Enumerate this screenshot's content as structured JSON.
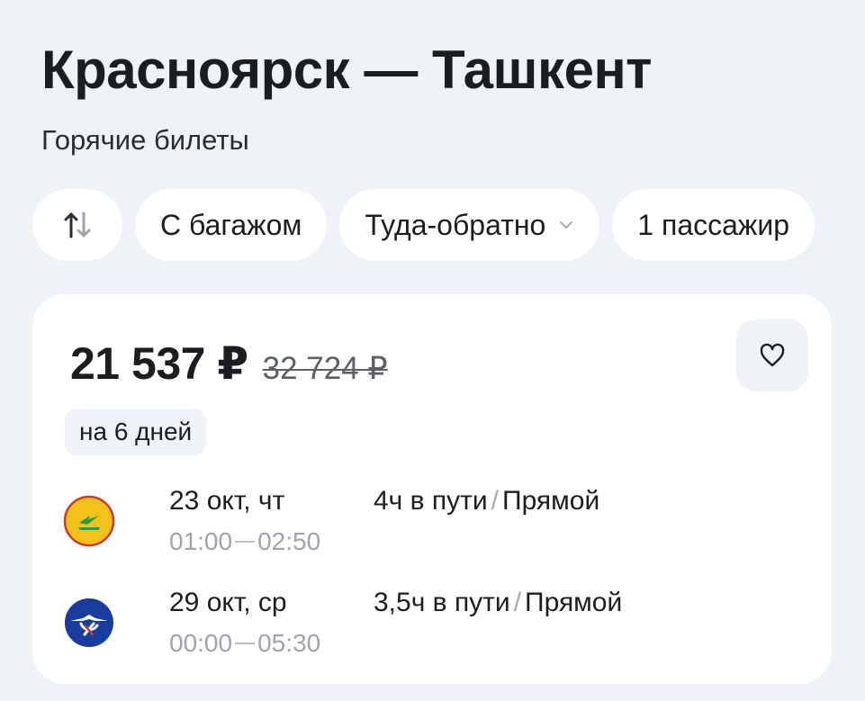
{
  "header": {
    "title": "Красноярск — Ташкент",
    "subtitle": "Горячие билеты"
  },
  "filters": {
    "swap_icon": "swap-vertical-arrows-icon",
    "baggage_label": "С багажом",
    "trip_type_label": "Туда-обратно",
    "passengers_label": "1 пассажир"
  },
  "offer": {
    "price": "21 537 ₽",
    "old_price": "32 724 ₽",
    "duration_badge": "на 6 дней",
    "favorite_icon": "heart-outline-icon",
    "segments": [
      {
        "airline_logo": "uzbekistan-airways-logo",
        "date": "23 окт, чт",
        "departure": "01:00",
        "arrival": "02:50",
        "travel_time": "4ч в пути",
        "separator": "/",
        "stops": "Прямой"
      },
      {
        "airline_logo": "aeroflot-logo",
        "date": "29 окт, ср",
        "departure": "00:00",
        "arrival": "05:30",
        "travel_time": "3,5ч в пути",
        "separator": "/",
        "stops": "Прямой"
      }
    ]
  },
  "colors": {
    "background": "#eff2f6",
    "card": "#ffffff",
    "text_primary": "#1c1d21",
    "text_muted": "#9ea3ad",
    "uzbekistan_yellow": "#f2c21c",
    "uzbekistan_green": "#2f9a3f",
    "aeroflot_blue": "#1a3c9c"
  }
}
